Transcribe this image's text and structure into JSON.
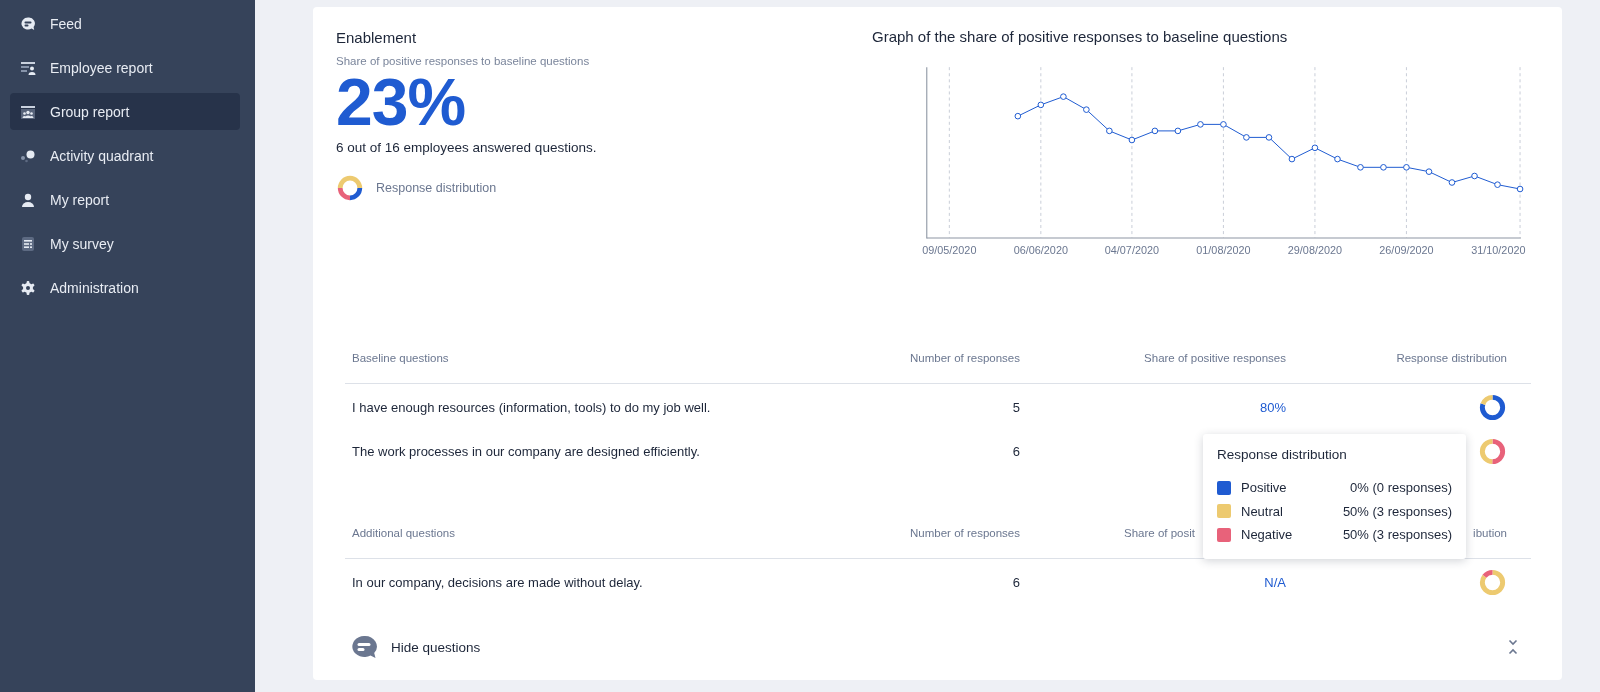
{
  "sidebar": {
    "items": [
      {
        "label": "Feed",
        "kind": "feed",
        "selected": false
      },
      {
        "label": "Employee report",
        "kind": "employee",
        "selected": false
      },
      {
        "label": "Group report",
        "kind": "group",
        "selected": true
      },
      {
        "label": "Activity quadrant",
        "kind": "quadrant",
        "selected": false
      },
      {
        "label": "My report",
        "kind": "person",
        "selected": false
      },
      {
        "label": "My survey",
        "kind": "survey",
        "selected": false
      },
      {
        "label": "Administration",
        "kind": "gear",
        "selected": false
      }
    ]
  },
  "summary": {
    "title": "Enablement",
    "subtitle": "Share of positive responses to baseline questions",
    "value": "23%",
    "note": "6 out of 16 employees answered questions.",
    "legend_label": "Response distribution"
  },
  "chart": {
    "title": "Graph of the share of positive responses to baseline questions",
    "x_labels": [
      "09/05/2020",
      "06/06/2020",
      "04/07/2020",
      "01/08/2020",
      "29/08/2020",
      "26/09/2020",
      "31/10/2020"
    ]
  },
  "tables": [
    {
      "columns": [
        {
          "label": "Baseline questions",
          "cut": false
        },
        {
          "label": "Number of responses",
          "cut": false
        },
        {
          "label": "Share of positive responses",
          "cut": false
        },
        {
          "label": "Response distribution",
          "cut": false
        }
      ],
      "rows": [
        {
          "question": "I have enough resources (information, tools) to do my job well.",
          "responses": "5",
          "share": "80%"
        },
        {
          "question": "The work processes in our company are designed efficiently.",
          "responses": "6"
        }
      ]
    },
    {
      "columns": [
        {
          "label": "Additional questions",
          "cut": false
        },
        {
          "label": "Number of responses",
          "cut": false
        },
        {
          "label": "Share of posit",
          "cut": true
        },
        {
          "label": "ibution",
          "cut": false
        }
      ],
      "rows": [
        {
          "question": "In our company, decisions are made without delay.",
          "responses": "6",
          "share": "N/A"
        }
      ]
    }
  ],
  "tooltip": {
    "title": "Response distribution",
    "items": [
      {
        "label": "Positive",
        "value": "0% (0 responses)",
        "color": "#1f5bd1"
      },
      {
        "label": "Neutral",
        "value": "50% (3 responses)",
        "color": "#edca70"
      },
      {
        "label": "Negative",
        "value": "50% (3 responses)",
        "color": "#e8627a"
      }
    ]
  },
  "toggle": {
    "label": "Hide questions"
  }
}
